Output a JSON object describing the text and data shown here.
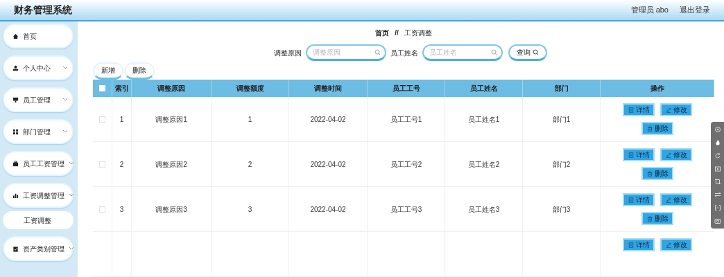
{
  "header": {
    "title": "财务管理系统",
    "user": "管理员 abo",
    "logout": "退出登录"
  },
  "sidebar": {
    "items": [
      {
        "label": "首页",
        "chevron": false
      },
      {
        "label": "个人中心",
        "chevron": true
      },
      {
        "label": "员工管理",
        "chevron": true
      },
      {
        "label": "部门管理",
        "chevron": true
      },
      {
        "label": "员工工资管理",
        "chevron": true
      },
      {
        "label": "工资调整管理",
        "chevron": true,
        "children": [
          {
            "label": "工资调整"
          }
        ]
      },
      {
        "label": "资产类别管理",
        "chevron": true
      }
    ]
  },
  "breadcrumb": {
    "items": [
      "首页",
      "工资调整"
    ],
    "separator": "//"
  },
  "search": {
    "fields": [
      {
        "label": "调整原因",
        "placeholder": "调整原因"
      },
      {
        "label": "员工姓名",
        "placeholder": "员工姓名"
      }
    ],
    "button": "查询"
  },
  "actions": [
    "新增",
    "删除"
  ],
  "table": {
    "header_checked": false,
    "columns": [
      "索引",
      "调整原因",
      "调整额度",
      "调整时间",
      "员工工号",
      "员工姓名",
      "部门",
      "操作"
    ],
    "rows": [
      {
        "checked": false,
        "cells": [
          "1",
          "调整原因1",
          "1",
          "2022-04-02",
          "员工工号1",
          "员工姓名1",
          "部门1"
        ],
        "actions": [
          "详情",
          "修改",
          "删除"
        ]
      },
      {
        "checked": false,
        "cells": [
          "2",
          "调整原因2",
          "2",
          "2022-04-02",
          "员工工号2",
          "员工姓名2",
          "部门2"
        ],
        "actions": [
          "详情",
          "修改",
          "删除"
        ]
      },
      {
        "checked": false,
        "cells": [
          "3",
          "调整原因3",
          "3",
          "2022-04-02",
          "员工工号3",
          "员工姓名3",
          "部门3"
        ],
        "actions": [
          "详情",
          "修改",
          "删除"
        ]
      },
      {
        "actions": [
          "详情",
          "修改"
        ]
      }
    ]
  }
}
